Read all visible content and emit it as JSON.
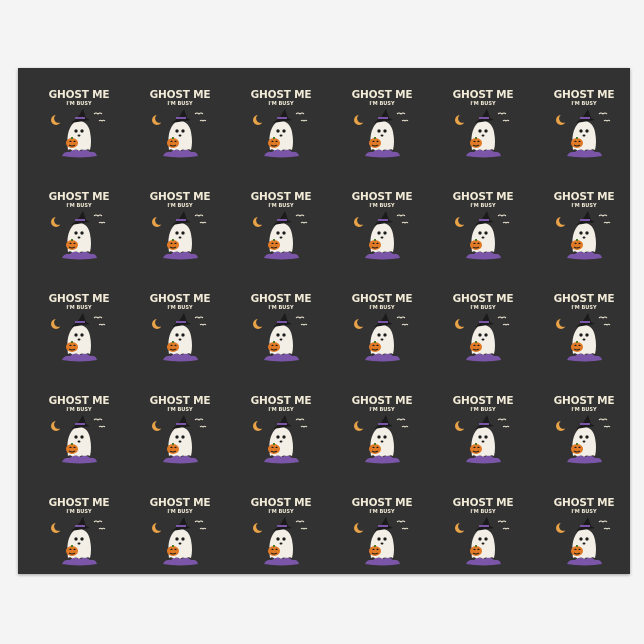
{
  "design": {
    "title": "GHOST ME",
    "subtitle": "I'M BUSY",
    "icons": [
      "crescent-moon-icon",
      "bat-icon",
      "witch-hat-icon",
      "ghost-icon",
      "jack-o-lantern-icon",
      "purple-cloud-icon"
    ]
  },
  "pattern": {
    "rows": 5,
    "columns": 6
  },
  "colors": {
    "paper": "#323232",
    "background": "#f4f4f4",
    "text": "#f1ead6",
    "moon": "#e8a248",
    "ghost": "#f3efe6",
    "pumpkin": "#e07a26",
    "cloud": "#7a55a8",
    "hat": "#1b1b1b"
  }
}
